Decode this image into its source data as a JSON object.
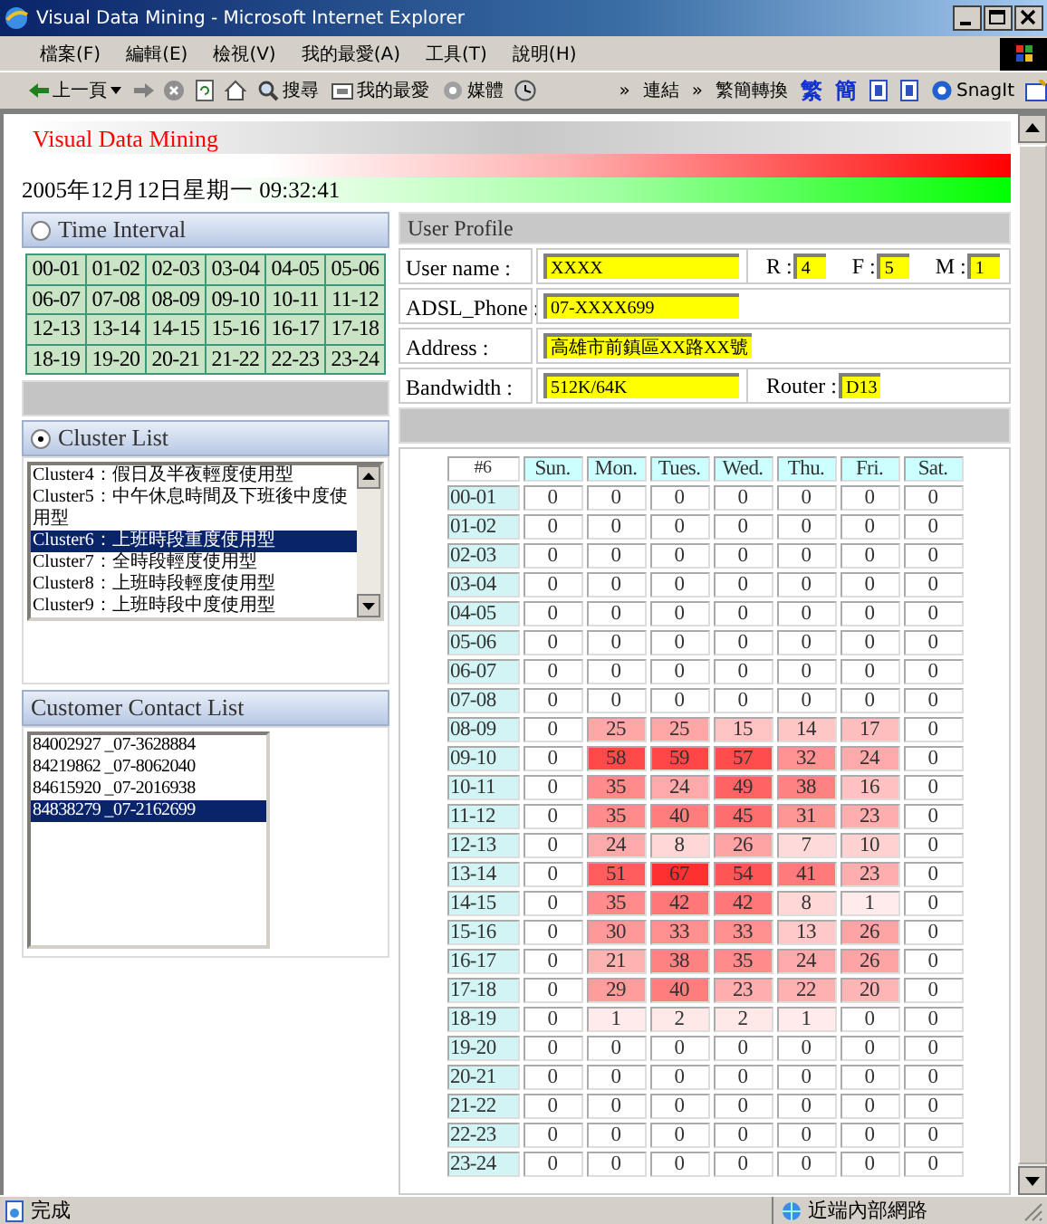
{
  "window": {
    "title": "Visual Data Mining - Microsoft Internet Explorer"
  },
  "menu": [
    "檔案(F)",
    "編輯(E)",
    "檢視(V)",
    "我的最愛(A)",
    "工具(T)",
    "說明(H)"
  ],
  "toolbar": [
    {
      "kind": "back",
      "label": "上一頁"
    },
    {
      "kind": "forward"
    },
    {
      "kind": "stop"
    },
    {
      "kind": "refresh"
    },
    {
      "kind": "home"
    },
    {
      "kind": "search",
      "label": "搜尋"
    },
    {
      "kind": "favorites",
      "label": "我的最愛"
    },
    {
      "kind": "media",
      "label": "媒體"
    },
    {
      "kind": "history"
    },
    {
      "kind": "chevron",
      "label": "»"
    },
    {
      "kind": "links",
      "label": "連結"
    },
    {
      "kind": "chevron",
      "label": "»"
    },
    {
      "kind": "convert",
      "label": "繁簡轉換"
    },
    {
      "kind": "script",
      "label": "繁"
    },
    {
      "kind": "script",
      "label": "簡"
    },
    {
      "kind": "doc"
    },
    {
      "kind": "doc"
    },
    {
      "kind": "snagit",
      "label": "SnagIt"
    },
    {
      "kind": "capture"
    }
  ],
  "page": {
    "title": "Visual Data Mining",
    "datetime": "2005年12月12日星期一 09:32:41"
  },
  "time_interval": {
    "label": "Time Interval",
    "selected": false,
    "cells": [
      "00-01",
      "01-02",
      "02-03",
      "03-04",
      "04-05",
      "05-06",
      "06-07",
      "07-08",
      "08-09",
      "09-10",
      "10-11",
      "11-12",
      "12-13",
      "13-14",
      "14-15",
      "15-16",
      "16-17",
      "17-18",
      "18-19",
      "19-20",
      "20-21",
      "21-22",
      "22-23",
      "23-24"
    ]
  },
  "cluster_list": {
    "label": "Cluster List",
    "selected": true,
    "items": [
      {
        "text": "Cluster4：假日及半夜輕度使用型",
        "selected": false
      },
      {
        "text": "Cluster5：中午休息時間及下班後中度使用型",
        "selected": false
      },
      {
        "text": "Cluster6：上班時段重度使用型",
        "selected": true
      },
      {
        "text": "Cluster7：全時段輕度使用型",
        "selected": false
      },
      {
        "text": "Cluster8：上班時段輕度使用型",
        "selected": false
      },
      {
        "text": "Cluster9：上班時段中度使用型",
        "selected": false
      }
    ]
  },
  "customer_contact_list": {
    "title": "Customer Contact List",
    "items": [
      {
        "text": "84002927 _07-3628884",
        "selected": false
      },
      {
        "text": "84219862 _07-8062040",
        "selected": false
      },
      {
        "text": "84615920 _07-2016938",
        "selected": false
      },
      {
        "text": "84838279 _07-2162699",
        "selected": true
      }
    ]
  },
  "user_profile": {
    "title": "User Profile",
    "rows": [
      {
        "fields": [
          {
            "label": "User name :",
            "value": "XXXX"
          },
          {
            "label": "R :",
            "value": "4"
          },
          {
            "label": "F :",
            "value": "5"
          },
          {
            "label": "M :",
            "value": "1"
          }
        ]
      },
      {
        "fields": [
          {
            "label": "ADSL_Phone :",
            "value": "07-XXXX699"
          }
        ]
      },
      {
        "fields": [
          {
            "label": "Address :",
            "value": "高雄市前鎮區XX路XX號"
          }
        ]
      },
      {
        "fields": [
          {
            "label": "Bandwidth :",
            "value": "512K/64K"
          },
          {
            "label": "Router :",
            "value": "D13"
          }
        ]
      }
    ]
  },
  "usage_table": {
    "corner": "#6",
    "columns": [
      "Sun.",
      "Mon.",
      "Tues.",
      "Wed.",
      "Thu.",
      "Fri.",
      "Sat."
    ],
    "rows": [
      {
        "label": "00-01",
        "values": [
          "0",
          "0",
          "0",
          "0",
          "0",
          "0",
          "0"
        ]
      },
      {
        "label": "01-02",
        "values": [
          "0",
          "0",
          "0",
          "0",
          "0",
          "0",
          "0"
        ]
      },
      {
        "label": "02-03",
        "values": [
          "0",
          "0",
          "0",
          "0",
          "0",
          "0",
          "0"
        ]
      },
      {
        "label": "03-04",
        "values": [
          "0",
          "0",
          "0",
          "0",
          "0",
          "0",
          "0"
        ]
      },
      {
        "label": "04-05",
        "values": [
          "0",
          "0",
          "0",
          "0",
          "0",
          "0",
          "0"
        ]
      },
      {
        "label": "05-06",
        "values": [
          "0",
          "0",
          "0",
          "0",
          "0",
          "0",
          "0"
        ]
      },
      {
        "label": "06-07",
        "values": [
          "0",
          "0",
          "0",
          "0",
          "0",
          "0",
          "0"
        ]
      },
      {
        "label": "07-08",
        "values": [
          "0",
          "0",
          "0",
          "0",
          "0",
          "0",
          "0"
        ]
      },
      {
        "label": "08-09",
        "values": [
          "0",
          "25",
          "25",
          "15",
          "14",
          "17",
          "0"
        ]
      },
      {
        "label": "09-10",
        "values": [
          "0",
          "58",
          "59",
          "57",
          "32",
          "24",
          "0"
        ]
      },
      {
        "label": "10-11",
        "values": [
          "0",
          "35",
          "24",
          "49",
          "38",
          "16",
          "0"
        ]
      },
      {
        "label": "11-12",
        "values": [
          "0",
          "35",
          "40",
          "45",
          "31",
          "23",
          "0"
        ]
      },
      {
        "label": "12-13",
        "values": [
          "0",
          "24",
          "8",
          "26",
          "7",
          "10",
          "0"
        ]
      },
      {
        "label": "13-14",
        "values": [
          "0",
          "51",
          "67",
          "54",
          "41",
          "23",
          "0"
        ]
      },
      {
        "label": "14-15",
        "values": [
          "0",
          "35",
          "42",
          "42",
          "8",
          "1",
          "0"
        ]
      },
      {
        "label": "15-16",
        "values": [
          "0",
          "30",
          "33",
          "33",
          "13",
          "26",
          "0"
        ]
      },
      {
        "label": "16-17",
        "values": [
          "0",
          "21",
          "38",
          "35",
          "24",
          "26",
          "0"
        ]
      },
      {
        "label": "17-18",
        "values": [
          "0",
          "29",
          "40",
          "23",
          "22",
          "20",
          "0"
        ]
      },
      {
        "label": "18-19",
        "values": [
          "0",
          "1",
          "2",
          "2",
          "1",
          "0",
          "0"
        ]
      },
      {
        "label": "19-20",
        "values": [
          "0",
          "0",
          "0",
          "0",
          "0",
          "0",
          "0"
        ]
      },
      {
        "label": "20-21",
        "values": [
          "0",
          "0",
          "0",
          "0",
          "0",
          "0",
          "0"
        ]
      },
      {
        "label": "21-22",
        "values": [
          "0",
          "0",
          "0",
          "0",
          "0",
          "0",
          "0"
        ]
      },
      {
        "label": "22-23",
        "values": [
          "0",
          "0",
          "0",
          "0",
          "0",
          "0",
          "0"
        ]
      },
      {
        "label": "23-24",
        "values": [
          "0",
          "0",
          "0",
          "0",
          "0",
          "0",
          "0"
        ]
      }
    ]
  },
  "status_bar": {
    "text": "完成",
    "zone": "近端內部網路"
  }
}
